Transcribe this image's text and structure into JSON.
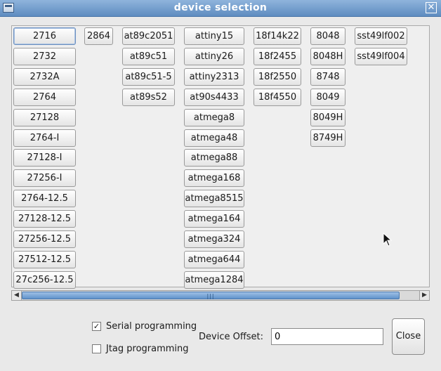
{
  "window": {
    "title": "device selection",
    "close_glyph": "✕"
  },
  "devices": {
    "columns": [
      [
        "2716",
        "2732",
        "2732A",
        "2764",
        "27128",
        "2764-I",
        "27128-I",
        "27256-I",
        "2764-12.5",
        "27128-12.5",
        "27256-12.5",
        "27512-12.5",
        "27c256-12.5"
      ],
      [
        "2864"
      ],
      [
        "at89c2051",
        "at89c51",
        "at89c51-5",
        "at89s52"
      ],
      [
        "attiny15",
        "attiny26",
        "attiny2313",
        "at90s4433",
        "atmega8",
        "atmega48",
        "atmega88",
        "atmega168",
        "atmega8515",
        "atmega164",
        "atmega324",
        "atmega644",
        "atmega1284"
      ],
      [
        "18f14k22",
        "18f2455",
        "18f2550",
        "18f4550"
      ],
      [
        "8048",
        "8048H",
        "8748",
        "8049",
        "8049H",
        "8749H"
      ],
      [
        "sst49lf002",
        "sst49lf004"
      ]
    ],
    "selected": "2716"
  },
  "scrollbar": {
    "grip": "|||",
    "left_arrow": "◀",
    "right_arrow": "▶"
  },
  "options": {
    "serial_label": "Serial programming",
    "serial_checked": true,
    "jtag_label": "Jtag programming",
    "jtag_checked": false,
    "offset_label": "Device Offset:",
    "offset_value": "0"
  },
  "close_label": "Close",
  "icons": {
    "window_menu": "window-menu-icon",
    "close": "close-icon",
    "check": "checkmark-icon"
  }
}
